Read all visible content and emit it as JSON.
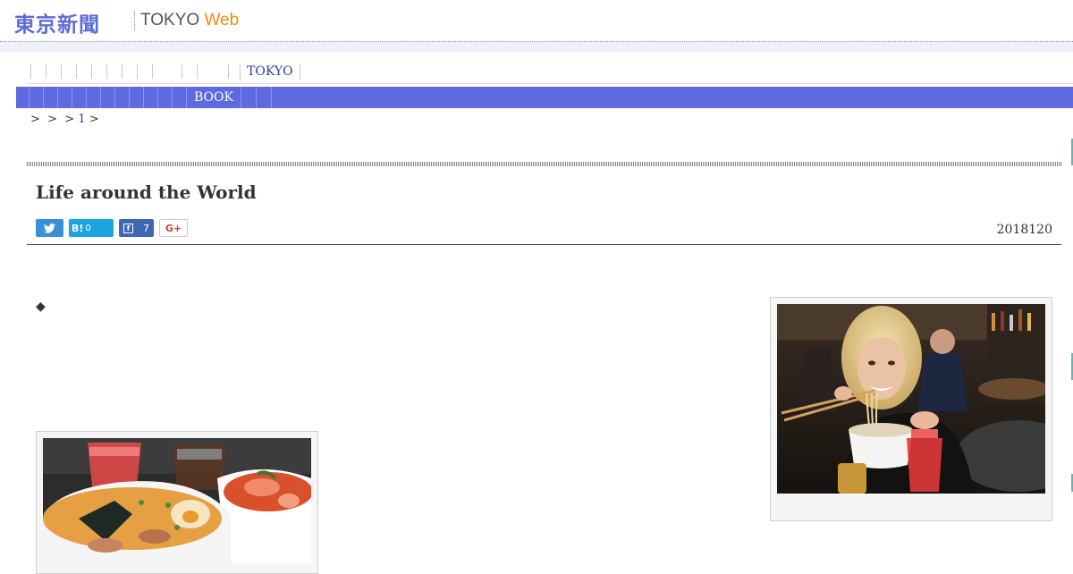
{
  "header": {
    "logo_jp": "東京新聞",
    "logo_en_tokyo": "TOKYO",
    "logo_en_web": "Web"
  },
  "nav_primary": {
    "active_label": "TOKYO"
  },
  "nav_secondary": {
    "active_label": "BOOK"
  },
  "breadcrumb": {
    "sep1": ">",
    "sep2": ">",
    "sep3": ">",
    "page": "1",
    "sep4": ">"
  },
  "article": {
    "title": "Life around the World",
    "date": "2018120",
    "bullet": "◆"
  },
  "share": {
    "twitter_icon": "twitter-icon",
    "hatena_label": "B!",
    "hatena_count": "0",
    "facebook_count": "7",
    "googleplus_label": "G+"
  },
  "colors": {
    "brand_blue": "#5d6ad7",
    "nav_bar": "#5f6ae0",
    "web_orange": "#ef8b15"
  },
  "images": {
    "right_photo": "woman-eating-ramen-photo",
    "left_photo": "ramen-bowls-photo"
  }
}
